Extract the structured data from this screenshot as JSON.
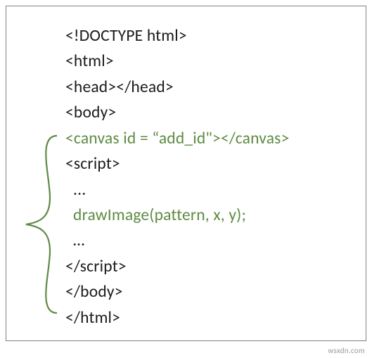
{
  "code": {
    "lines": [
      {
        "text": "<!DOCTYPE html>",
        "highlight": false
      },
      {
        "text": "<html>",
        "highlight": false
      },
      {
        "text": "<head></head>",
        "highlight": false
      },
      {
        "text": "<body>",
        "highlight": false
      },
      {
        "text": "<canvas id = “add_id\"></canvas>",
        "highlight": true
      },
      {
        "text": "<script>",
        "highlight": false
      },
      {
        "text": "  ...",
        "highlight": false
      },
      {
        "text": "  drawImage(pattern, x, y);",
        "highlight": true
      },
      {
        "text": "  …",
        "highlight": false
      },
      {
        "text": "</script>",
        "highlight": false
      },
      {
        "text": "</body>",
        "highlight": false
      },
      {
        "text": "</html>",
        "highlight": false
      }
    ],
    "bracket_start": 4,
    "bracket_end": 9
  },
  "watermark": "wsxdn.com"
}
